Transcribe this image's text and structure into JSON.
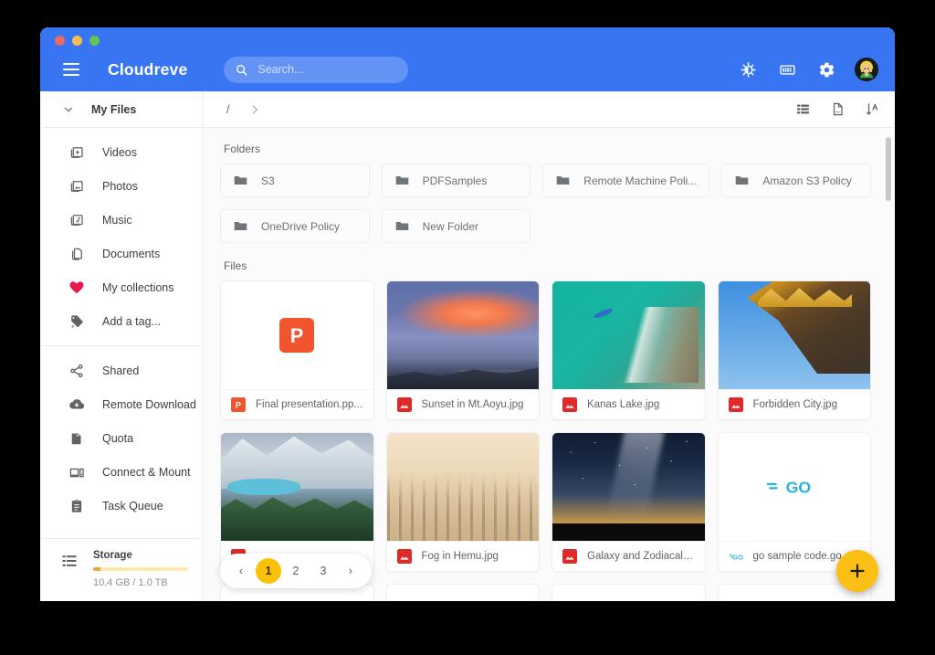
{
  "app": {
    "brand": "Cloudreve",
    "accent_blue": "#3775f3",
    "accent_yellow": "#fcbf15"
  },
  "titlebar": {
    "traffic_lights": [
      "close",
      "minimize",
      "maximize"
    ]
  },
  "search": {
    "placeholder": "Search...",
    "value": ""
  },
  "header_actions": [
    {
      "name": "dark-mode-icon",
      "label": "Toggle dark mode"
    },
    {
      "name": "storage-icon",
      "label": "Storage"
    },
    {
      "name": "gear-icon",
      "label": "Settings"
    }
  ],
  "avatar": {
    "label": "User avatar"
  },
  "sidebar": {
    "root": {
      "label": "My Files",
      "expanded": true
    },
    "groups": [
      {
        "items": [
          {
            "label": "Videos",
            "icon": "videos-icon"
          },
          {
            "label": "Photos",
            "icon": "photos-icon"
          },
          {
            "label": "Music",
            "icon": "music-icon"
          },
          {
            "label": "Documents",
            "icon": "documents-icon"
          },
          {
            "label": "My collections",
            "icon": "heart-icon"
          },
          {
            "label": "Add a tag...",
            "icon": "add-tag-icon"
          }
        ]
      },
      {
        "items": [
          {
            "label": "Shared",
            "icon": "share-icon"
          },
          {
            "label": "Remote Download",
            "icon": "cloud-download-icon"
          },
          {
            "label": "Quota",
            "icon": "quota-icon"
          },
          {
            "label": "Connect & Mount",
            "icon": "connect-mount-icon"
          },
          {
            "label": "Task Queue",
            "icon": "task-queue-icon"
          }
        ]
      }
    ],
    "storage": {
      "title": "Storage",
      "quota": "10.4 GB / 1.0 TB",
      "used_percent": 8,
      "bar_color": "#f2a33c"
    }
  },
  "breadcrumb": {
    "root": "/",
    "chevron": "chevron-right-icon"
  },
  "view_controls": [
    {
      "name": "list-view-icon",
      "label": "List view"
    },
    {
      "name": "file-page-icon",
      "label": "File options"
    },
    {
      "name": "sort-az-icon",
      "label": "Sort"
    }
  ],
  "main": {
    "folders_title": "Folders",
    "files_title": "Files",
    "folders": [
      {
        "name": "S3"
      },
      {
        "name": "PDFSamples"
      },
      {
        "name": "Remote Machine Poli..."
      },
      {
        "name": "Amazon S3 Policy"
      },
      {
        "name": "OneDrive Policy"
      },
      {
        "name": "New Folder"
      }
    ],
    "files": [
      {
        "name": "Final presentation.pp...",
        "icon": "powerpoint-icon",
        "thumb": "none"
      },
      {
        "name": "Sunset in Mt.Aoyu.jpg",
        "icon": "image-icon",
        "thumb": "sunset"
      },
      {
        "name": "Kanas Lake.jpg",
        "icon": "image-icon",
        "thumb": "kanas"
      },
      {
        "name": "Forbidden City.jpg",
        "icon": "image-icon",
        "thumb": "forbidden"
      },
      {
        "name": "",
        "icon": "image-icon",
        "thumb": "lake"
      },
      {
        "name": "Fog in Hemu.jpg",
        "icon": "image-icon",
        "thumb": "fog"
      },
      {
        "name": "Galaxy and Zodiacal ...",
        "icon": "image-icon",
        "thumb": "galaxy"
      },
      {
        "name": "go sample code.go",
        "icon": "go-icon",
        "thumb": "go"
      }
    ]
  },
  "pagination": {
    "prev": "‹",
    "next": "›",
    "pages": [
      "1",
      "2",
      "3"
    ],
    "current": "1"
  },
  "fab": {
    "label": "+"
  }
}
